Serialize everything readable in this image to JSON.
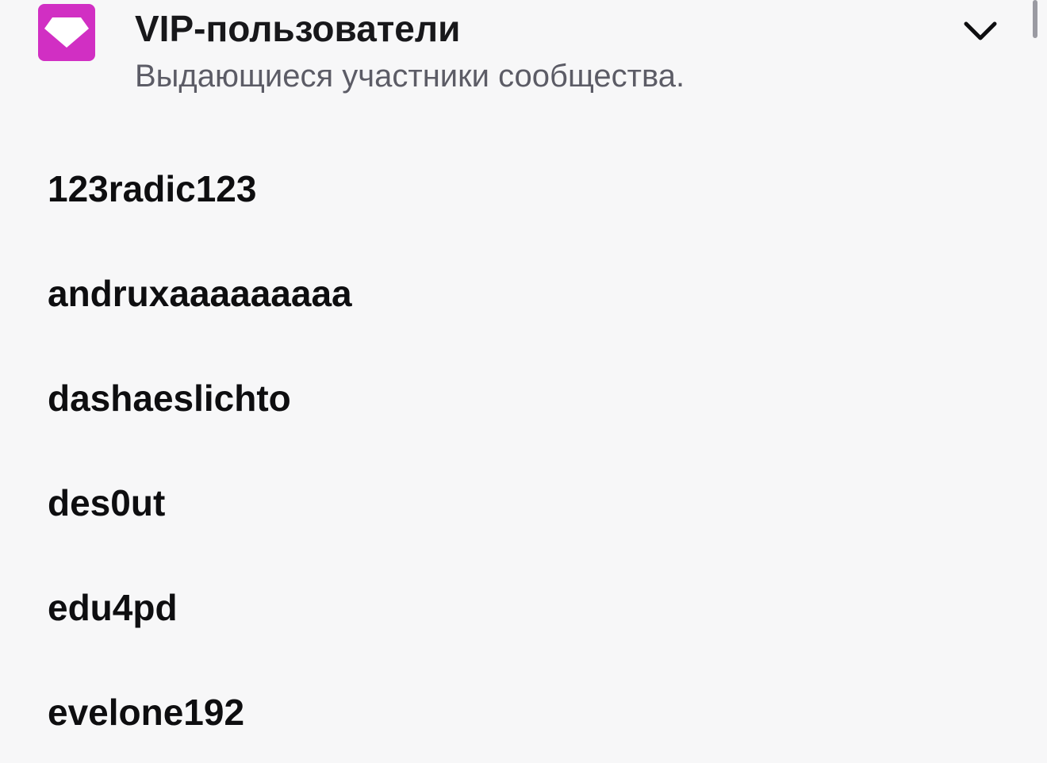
{
  "section": {
    "title": "VIP-пользователи",
    "subtitle": "Выдающиеся участники сообщества.",
    "icon": "vip-diamond-icon",
    "icon_bg_color": "#d12fc3",
    "expand_icon": "chevron-down-icon"
  },
  "users": [
    {
      "name": "123radic123"
    },
    {
      "name": "andruxaaaaaaaaa"
    },
    {
      "name": "dashaeslichto"
    },
    {
      "name": "des0ut"
    },
    {
      "name": "edu4pd"
    },
    {
      "name": "evelone192"
    }
  ],
  "colors": {
    "background": "#f7f7f8",
    "title_text": "#18181b",
    "subtitle_text": "#5c5c66",
    "username_text": "#0e0e10",
    "scrollbar": "#9a9aa2"
  }
}
